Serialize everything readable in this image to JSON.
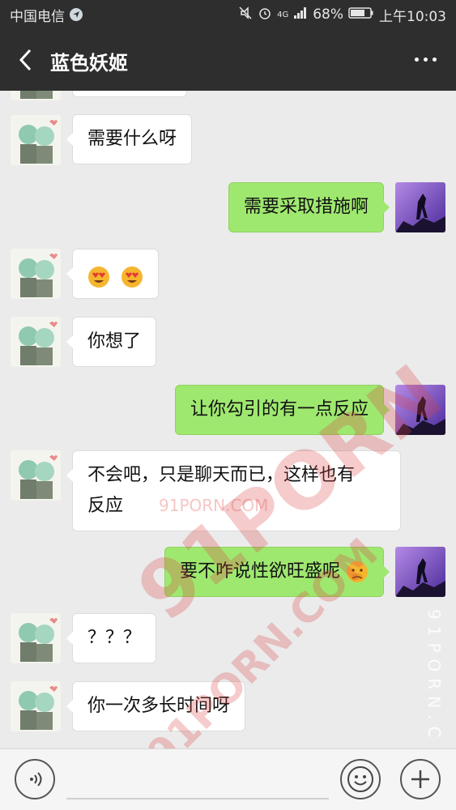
{
  "status_bar": {
    "carrier": "中国电信",
    "network": "4G",
    "battery": "68%",
    "time": "上午10:03"
  },
  "header": {
    "title": "蓝色妖姬"
  },
  "messages": [
    {
      "side": "left",
      "text": "需要什么呀"
    },
    {
      "side": "right",
      "text": "需要采取措施啊"
    },
    {
      "side": "left",
      "text": "",
      "emojis": [
        "heart-eyes-emoji",
        "heart-eyes-emoji"
      ]
    },
    {
      "side": "left",
      "text": "你想了"
    },
    {
      "side": "right",
      "text": "让你勾引的有一点反应"
    },
    {
      "side": "left",
      "line1": "不会吧，只是聊天而已，这样也有",
      "line2": "反应"
    },
    {
      "side": "right",
      "text": "要不咋说性欲旺盛呢",
      "emoji": "shy-emoji"
    },
    {
      "side": "left",
      "text": "？？？"
    },
    {
      "side": "left",
      "text": "你一次多长时间呀"
    }
  ],
  "watermark": {
    "small": "91PORN.COM",
    "big": "91PORN",
    "arc": "91PORN.COM",
    "vertical": "91PORN.C"
  },
  "colors": {
    "header_bg": "#2e2e2e",
    "chat_bg": "#ebebeb",
    "sent_bubble": "#9fe870",
    "received_bubble": "#ffffff"
  }
}
